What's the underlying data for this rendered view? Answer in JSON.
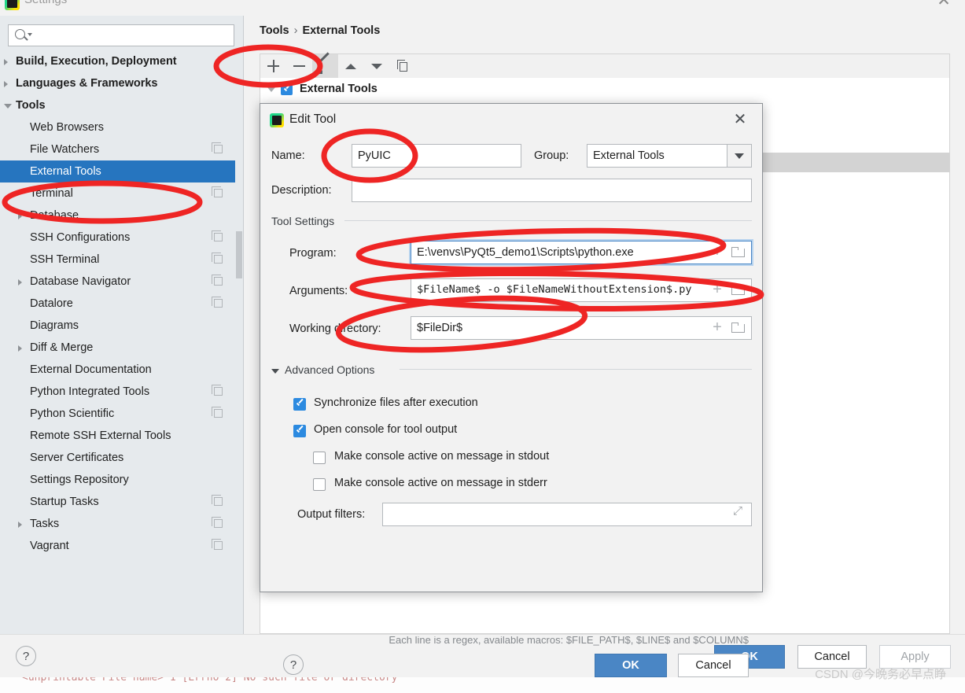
{
  "window": {
    "title": "Settings",
    "icon": "pycharm-icon",
    "close_label": "✕"
  },
  "search": {
    "placeholder": "",
    "value": "",
    "icon": "search-icon"
  },
  "sidebar": {
    "items": [
      {
        "label": "Build, Execution, Deployment",
        "depth": 0,
        "bold": true,
        "arrow": "collapsed",
        "copy": false
      },
      {
        "label": "Languages & Frameworks",
        "depth": 0,
        "bold": true,
        "arrow": "collapsed",
        "copy": false
      },
      {
        "label": "Tools",
        "depth": 0,
        "bold": true,
        "arrow": "expanded",
        "copy": false
      },
      {
        "label": "Web Browsers",
        "depth": 1,
        "bold": false,
        "arrow": "none",
        "copy": false
      },
      {
        "label": "File Watchers",
        "depth": 1,
        "bold": false,
        "arrow": "none",
        "copy": true
      },
      {
        "label": "External Tools",
        "depth": 1,
        "bold": false,
        "arrow": "none",
        "copy": false,
        "selected": true
      },
      {
        "label": "Terminal",
        "depth": 1,
        "bold": false,
        "arrow": "none",
        "copy": true
      },
      {
        "label": "Database",
        "depth": 1,
        "bold": false,
        "arrow": "collapsed",
        "copy": false
      },
      {
        "label": "SSH Configurations",
        "depth": 1,
        "bold": false,
        "arrow": "none",
        "copy": true
      },
      {
        "label": "SSH Terminal",
        "depth": 1,
        "bold": false,
        "arrow": "none",
        "copy": true
      },
      {
        "label": "Database Navigator",
        "depth": 1,
        "bold": false,
        "arrow": "collapsed",
        "copy": true
      },
      {
        "label": "Datalore",
        "depth": 1,
        "bold": false,
        "arrow": "none",
        "copy": true
      },
      {
        "label": "Diagrams",
        "depth": 1,
        "bold": false,
        "arrow": "none",
        "copy": false
      },
      {
        "label": "Diff & Merge",
        "depth": 1,
        "bold": false,
        "arrow": "collapsed",
        "copy": false
      },
      {
        "label": "External Documentation",
        "depth": 1,
        "bold": false,
        "arrow": "none",
        "copy": false
      },
      {
        "label": "Python Integrated Tools",
        "depth": 1,
        "bold": false,
        "arrow": "none",
        "copy": true
      },
      {
        "label": "Python Scientific",
        "depth": 1,
        "bold": false,
        "arrow": "none",
        "copy": true
      },
      {
        "label": "Remote SSH External Tools",
        "depth": 1,
        "bold": false,
        "arrow": "none",
        "copy": false
      },
      {
        "label": "Server Certificates",
        "depth": 1,
        "bold": false,
        "arrow": "none",
        "copy": false
      },
      {
        "label": "Settings Repository",
        "depth": 1,
        "bold": false,
        "arrow": "none",
        "copy": false
      },
      {
        "label": "Startup Tasks",
        "depth": 1,
        "bold": false,
        "arrow": "none",
        "copy": true
      },
      {
        "label": "Tasks",
        "depth": 1,
        "bold": false,
        "arrow": "collapsed",
        "copy": true
      },
      {
        "label": "Vagrant",
        "depth": 1,
        "bold": false,
        "arrow": "none",
        "copy": true
      }
    ]
  },
  "breadcrumb": {
    "root": "Tools",
    "separator": "›",
    "leaf": "External Tools"
  },
  "toolbar": {
    "add_label": "+",
    "remove_label": "−",
    "edit_label": "edit",
    "up_label": "move-up",
    "down_label": "move-down",
    "copy_label": "copy"
  },
  "tool_tree": {
    "group_label": "External Tools",
    "group_checked": true,
    "child_label": "",
    "child_checked": true
  },
  "dialog": {
    "title": "Edit Tool",
    "close_label": "✕",
    "name_label": "Name:",
    "name_value": "PyUIC",
    "group_label": "Group:",
    "group_value": "External Tools",
    "description_label": "Description:",
    "description_value": "",
    "tool_settings_title": "Tool Settings",
    "program_label": "Program:",
    "program_value": "E:\\venvs\\PyQt5_demo1\\Scripts\\python.exe",
    "arguments_label": "Arguments:",
    "arguments_value": "$FileName$ -o $FileNameWithoutExtension$.py",
    "working_dir_label": "Working directory:",
    "working_dir_value": "$FileDir$",
    "advanced_title": "Advanced Options",
    "checkboxes": [
      {
        "label": "Synchronize files after execution",
        "checked": true,
        "indent": 0
      },
      {
        "label": "Open console for tool output",
        "checked": true,
        "indent": 0
      },
      {
        "label": "Make console active on message in stdout",
        "checked": false,
        "indent": 1
      },
      {
        "label": "Make console active on message in stderr",
        "checked": false,
        "indent": 1
      }
    ],
    "output_filters_label": "Output filters:",
    "output_filters_value": "",
    "output_hint": "Each line is a regex, available macros: $FILE_PATH$, $LINE$ and $COLUMN$",
    "help_label": "?",
    "ok_label": "OK",
    "cancel_label": "Cancel"
  },
  "footer": {
    "help_label": "?",
    "ok_label": "OK",
    "cancel_label": "Cancel",
    "apply_label": "Apply"
  },
  "console": {
    "text": "<unprintable File name> 1 [Errno 2] No such file or directory"
  },
  "watermark": {
    "text": "CSDN @今晩务必早点睁"
  },
  "colors": {
    "accent_blue": "#2675bf",
    "button_blue": "#4a86c5",
    "checkbox_blue": "#2c8ae0",
    "annotation_red": "#ee2524",
    "sidebar_bg": "#e6eaed",
    "dialog_bg": "#f2f2f2"
  },
  "annotations": {
    "shape": "ellipse",
    "color": "#ee2524",
    "count": 6,
    "targets": [
      "toolbar-add-remove",
      "sidebar-item-external-tools",
      "name-field",
      "program-field",
      "arguments-field",
      "working-directory-field"
    ]
  }
}
